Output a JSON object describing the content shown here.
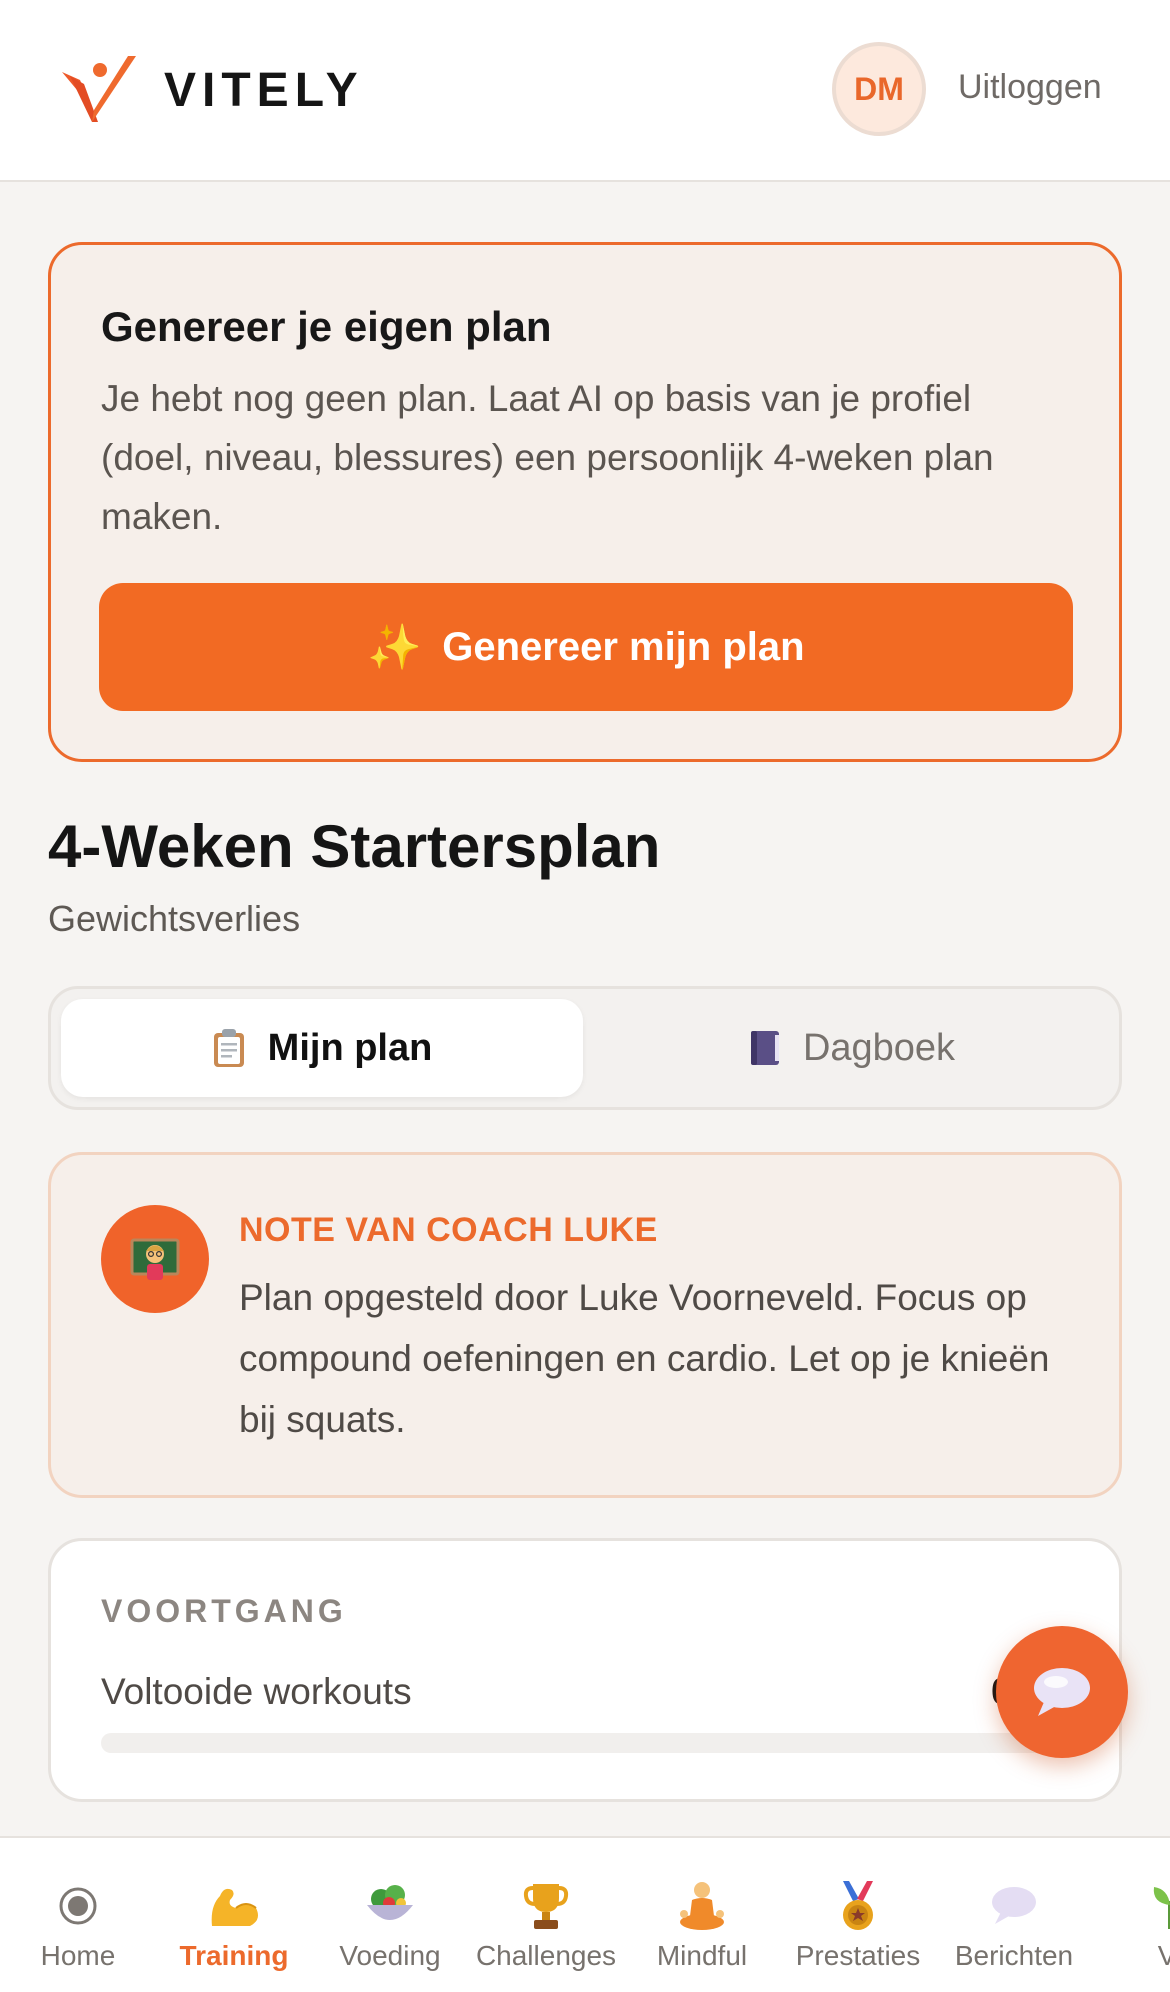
{
  "header": {
    "brand": "VITELY",
    "avatar_initials": "DM",
    "logout_label": "Uitloggen"
  },
  "generate_card": {
    "title": "Genereer je eigen plan",
    "description": "Je hebt nog geen plan. Laat AI op basis van je profiel (doel, niveau, blessures) een persoonlijk 4-weken plan maken.",
    "button_label": "Genereer mijn plan",
    "button_icon": "sparkles-icon"
  },
  "plan": {
    "title": "4-Weken Startersplan",
    "subtitle": "Gewichtsverlies"
  },
  "tabs": [
    {
      "label": "Mijn plan",
      "icon": "clipboard-icon",
      "active": true
    },
    {
      "label": "Dagboek",
      "icon": "notebook-icon",
      "active": false
    }
  ],
  "coach_note": {
    "label": "NOTE VAN COACH LUKE",
    "text": "Plan opgesteld door Luke Voorneveld. Focus op compound oefeningen en cardio. Let op je knieën bij squats.",
    "icon": "teacher-icon"
  },
  "progress": {
    "label": "VOORTGANG",
    "item_label": "Voltooide workouts",
    "count": "0",
    "fill": 0
  },
  "chat_fab": {
    "icon": "speech-bubble-icon"
  },
  "bottom_nav": [
    {
      "label": "Home",
      "icon": "radio-dot-icon",
      "active": false
    },
    {
      "label": "Training",
      "icon": "flexed-biceps-icon",
      "active": true
    },
    {
      "label": "Voeding",
      "icon": "salad-icon",
      "active": false
    },
    {
      "label": "Challenges",
      "icon": "trophy-icon",
      "active": false
    },
    {
      "label": "Mindful",
      "icon": "meditation-icon",
      "active": false
    },
    {
      "label": "Prestaties",
      "icon": "medal-icon",
      "active": false
    },
    {
      "label": "Berichten",
      "icon": "speech-bubble-icon",
      "active": false
    },
    {
      "label": "Vi",
      "icon": "leaf-icon",
      "active": false
    }
  ],
  "colors": {
    "accent": "#f26a23",
    "background": "#f6f4f2",
    "card_tint": "#f6efea"
  }
}
